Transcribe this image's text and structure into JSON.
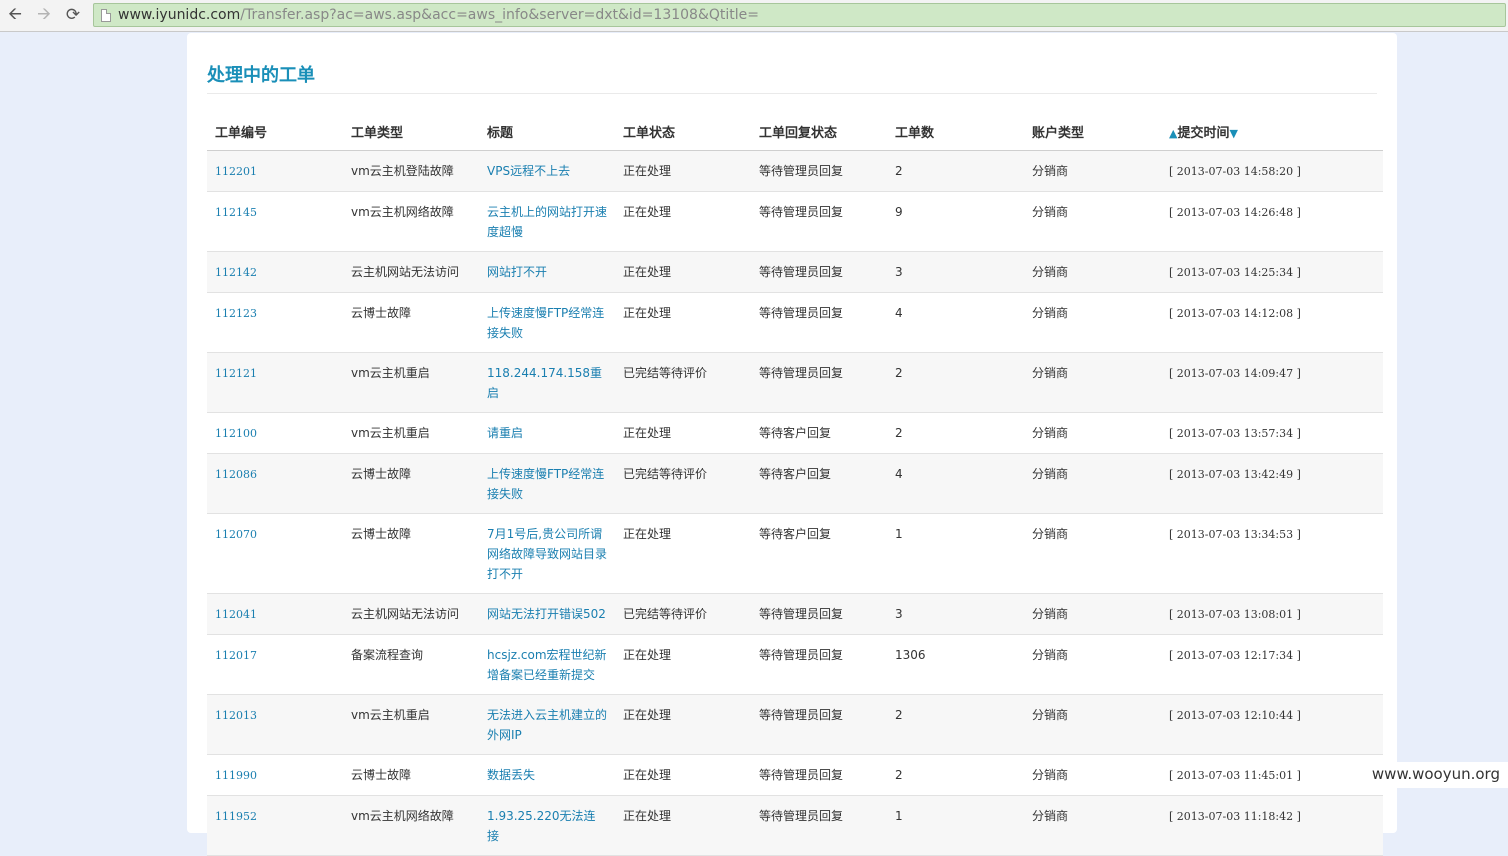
{
  "browser": {
    "url_host": "www.iyunidc.com",
    "url_path": "/Transfer.asp?ac=aws.asp&acc=aws_info&server=dxt&id=13108&Qtitle="
  },
  "page": {
    "title": "处理中的工单"
  },
  "table": {
    "headers": [
      "工单编号",
      "工单类型",
      "标题",
      "工单状态",
      "工单回复状态",
      "工单数",
      "账户类型",
      "提交时间"
    ],
    "rows": [
      {
        "id": "112201",
        "type": "vm云主机登陆故障",
        "title": "VPS远程不上去",
        "status": "正在处理",
        "reply": "等待管理员回复",
        "count": "2",
        "account": "分销商",
        "time": "[ 2013-07-03 14:58:20 ]"
      },
      {
        "id": "112145",
        "type": "vm云主机网络故障",
        "title": "云主机上的网站打开速度超慢",
        "status": "正在处理",
        "reply": "等待管理员回复",
        "count": "9",
        "account": "分销商",
        "time": "[ 2013-07-03 14:26:48 ]"
      },
      {
        "id": "112142",
        "type": "云主机网站无法访问",
        "title": "网站打不开",
        "status": "正在处理",
        "reply": "等待管理员回复",
        "count": "3",
        "account": "分销商",
        "time": "[ 2013-07-03 14:25:34 ]"
      },
      {
        "id": "112123",
        "type": "云博士故障",
        "title": "上传速度慢FTP经常连接失败",
        "status": "正在处理",
        "reply": "等待管理员回复",
        "count": "4",
        "account": "分销商",
        "time": "[ 2013-07-03 14:12:08 ]"
      },
      {
        "id": "112121",
        "type": "vm云主机重启",
        "title": "118.244.174.158重启",
        "status": "已完结等待评价",
        "reply": "等待管理员回复",
        "count": "2",
        "account": "分销商",
        "time": "[ 2013-07-03 14:09:47 ]"
      },
      {
        "id": "112100",
        "type": "vm云主机重启",
        "title": "请重启",
        "status": "正在处理",
        "reply": "等待客户回复",
        "count": "2",
        "account": "分销商",
        "time": "[ 2013-07-03 13:57:34 ]"
      },
      {
        "id": "112086",
        "type": "云博士故障",
        "title": "上传速度慢FTP经常连接失败",
        "status": "已完结等待评价",
        "reply": "等待客户回复",
        "count": "4",
        "account": "分销商",
        "time": "[ 2013-07-03 13:42:49 ]"
      },
      {
        "id": "112070",
        "type": "云博士故障",
        "title": "7月1号后,贵公司所谓网络故障导致网站目录打不开",
        "status": "正在处理",
        "reply": "等待客户回复",
        "count": "1",
        "account": "分销商",
        "time": "[ 2013-07-03 13:34:53 ]"
      },
      {
        "id": "112041",
        "type": "云主机网站无法访问",
        "title": "网站无法打开错误502",
        "status": "已完结等待评价",
        "reply": "等待管理员回复",
        "count": "3",
        "account": "分销商",
        "time": "[ 2013-07-03 13:08:01 ]"
      },
      {
        "id": "112017",
        "type": "备案流程查询",
        "title": "hcsjz.com宏程世纪新增备案已经重新提交",
        "status": "正在处理",
        "reply": "等待管理员回复",
        "count": "1306",
        "account": "分销商",
        "time": "[ 2013-07-03 12:17:34 ]"
      },
      {
        "id": "112013",
        "type": "vm云主机重启",
        "title": "无法进入云主机建立的外网IP",
        "status": "正在处理",
        "reply": "等待管理员回复",
        "count": "2",
        "account": "分销商",
        "time": "[ 2013-07-03 12:10:44 ]"
      },
      {
        "id": "111990",
        "type": "云博士故障",
        "title": "数据丢失",
        "status": "正在处理",
        "reply": "等待管理员回复",
        "count": "2",
        "account": "分销商",
        "time": "[ 2013-07-03 11:45:01 ]"
      },
      {
        "id": "111952",
        "type": "vm云主机网络故障",
        "title": "1.93.25.220无法连接",
        "status": "正在处理",
        "reply": "等待管理员回复",
        "count": "1",
        "account": "分销商",
        "time": "[ 2013-07-03 11:18:42 ]"
      }
    ]
  },
  "watermark": "www.wooyun.org",
  "icons": {
    "back": "back-arrow-icon",
    "forward": "forward-arrow-icon",
    "reload": "reload-icon",
    "page": "page-icon",
    "sort_up": "sort-up-icon",
    "sort_down": "sort-down-icon"
  },
  "colors": {
    "accent": "#1a8fb8",
    "link": "#1a7fb0",
    "address_bar": "#cfe8c6",
    "page_bg": "#e8eefa"
  }
}
